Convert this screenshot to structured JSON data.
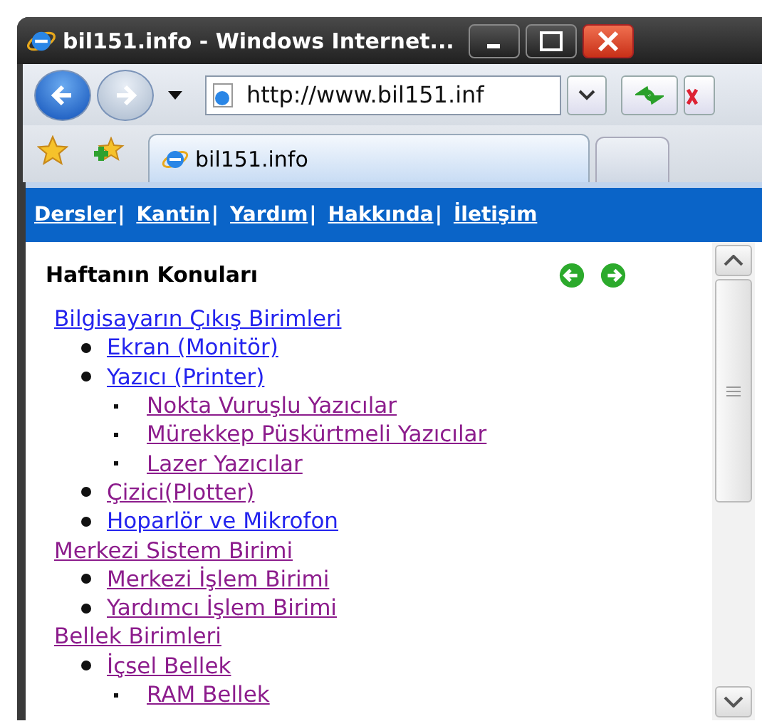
{
  "window": {
    "title": "bil151.info - Windows Internet..."
  },
  "address_bar": {
    "value": "http://www.bil151.inf"
  },
  "tabs": [
    {
      "label": "bil151.info",
      "selected": true
    }
  ],
  "nav_links": [
    {
      "label": "Dersler",
      "separator": "|"
    },
    {
      "label": "Kantin",
      "separator": "|"
    },
    {
      "label": "Yardım",
      "separator": "|"
    },
    {
      "label": "Hakkında",
      "separator": "|"
    },
    {
      "label": "İletişim"
    }
  ],
  "heading": "Haftanın Konuları",
  "topics": [
    {
      "label": "Bilgisayarın Çıkış Birimleri",
      "visited": false,
      "children": [
        {
          "label": "Ekran (Monitör)",
          "visited": false
        },
        {
          "label": "Yazıcı (Printer)",
          "visited": false,
          "children": [
            {
              "label": "Nokta Vuruşlu Yazıcılar",
              "visited": true
            },
            {
              "label": "Mürekkep Püskürtmeli Yazıcılar",
              "visited": true
            },
            {
              "label": "Lazer Yazıcılar",
              "visited": true
            }
          ]
        },
        {
          "label": "Çizici(Plotter)",
          "visited": true
        },
        {
          "label": "Hoparlör ve Mikrofon",
          "visited": false
        }
      ]
    },
    {
      "label": "Merkezi Sistem Birimi",
      "visited": true,
      "children": [
        {
          "label": "Merkezi İşlem Birimi",
          "visited": true
        },
        {
          "label": "Yardımcı İşlem Birimi",
          "visited": true
        }
      ]
    },
    {
      "label": "Bellek Birimleri",
      "visited": true,
      "children": [
        {
          "label": "İçsel Bellek",
          "visited": true,
          "children": [
            {
              "label": "RAM Bellek",
              "visited": true
            }
          ]
        }
      ]
    }
  ]
}
